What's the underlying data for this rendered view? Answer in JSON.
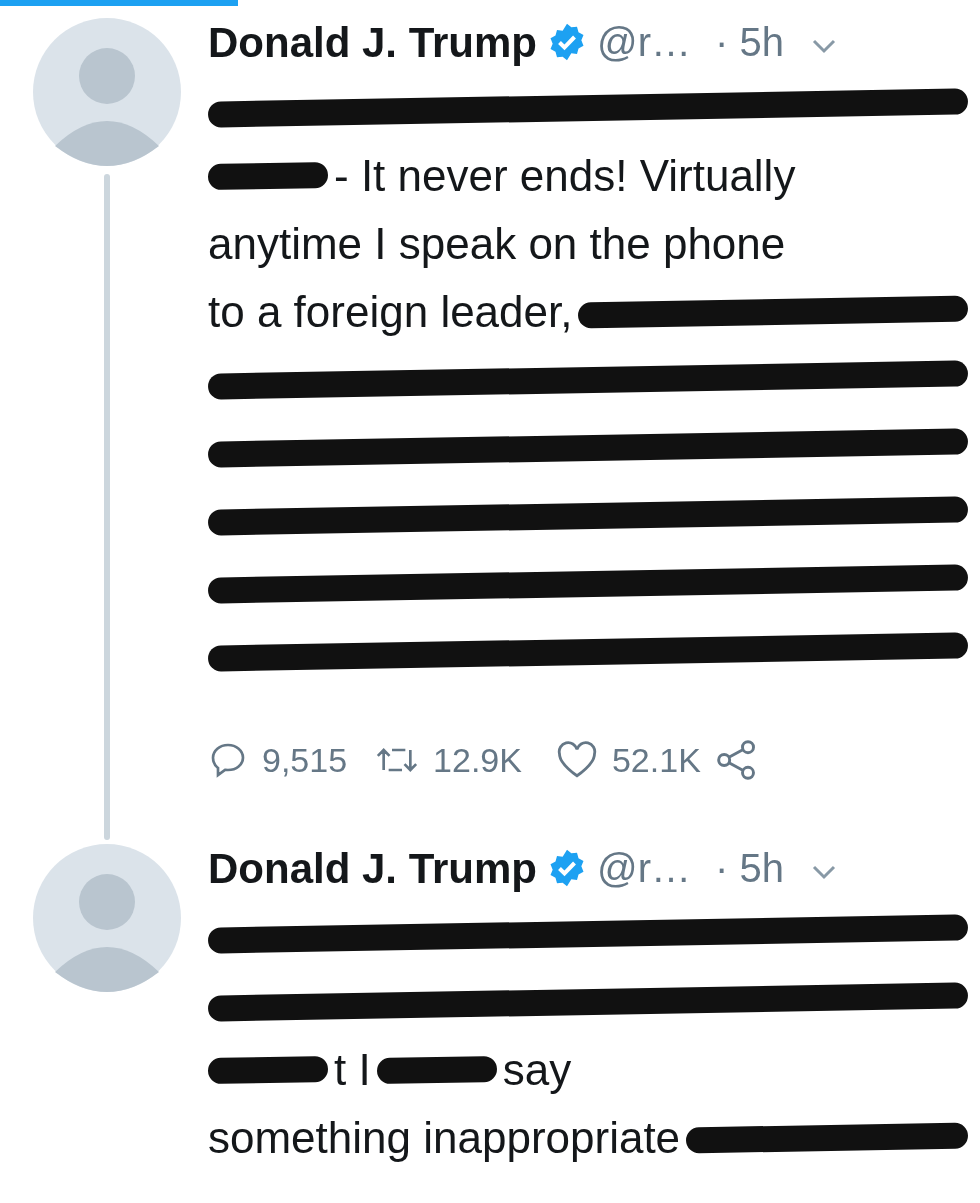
{
  "tweets": [
    {
      "author": "Donald J. Trump",
      "verified": true,
      "handle": "@r…",
      "time": "· 5h",
      "thread_below": true,
      "lines": [
        [
          {
            "kind": "redacted"
          }
        ],
        [
          {
            "kind": "redacted"
          },
          {
            "kind": "text",
            "text": "- It never ends! Virtually"
          }
        ],
        [
          {
            "kind": "text",
            "text": "anytime I speak on the phone"
          }
        ],
        [
          {
            "kind": "text",
            "text": "to a foreign leader,"
          },
          {
            "kind": "redacted"
          }
        ],
        [
          {
            "kind": "redacted"
          }
        ],
        [
          {
            "kind": "redacted"
          }
        ],
        [
          {
            "kind": "redacted"
          }
        ],
        [
          {
            "kind": "redacted"
          }
        ],
        [
          {
            "kind": "redacted"
          }
        ]
      ],
      "stats": {
        "replies": "9,515",
        "retweets": "12.9K",
        "likes": "52.1K"
      }
    },
    {
      "author": "Donald J. Trump",
      "verified": true,
      "handle": "@r…",
      "time": "· 5h",
      "thread_below": false,
      "lines": [
        [
          {
            "kind": "redacted"
          }
        ],
        [
          {
            "kind": "redacted"
          }
        ],
        [
          {
            "kind": "redacted"
          },
          {
            "kind": "text",
            "text": "t I"
          },
          {
            "kind": "redacted"
          },
          {
            "kind": "text",
            "text": "say"
          }
        ],
        [
          {
            "kind": "text",
            "text": "something inappropriate"
          },
          {
            "kind": "redacted"
          }
        ]
      ]
    }
  ]
}
